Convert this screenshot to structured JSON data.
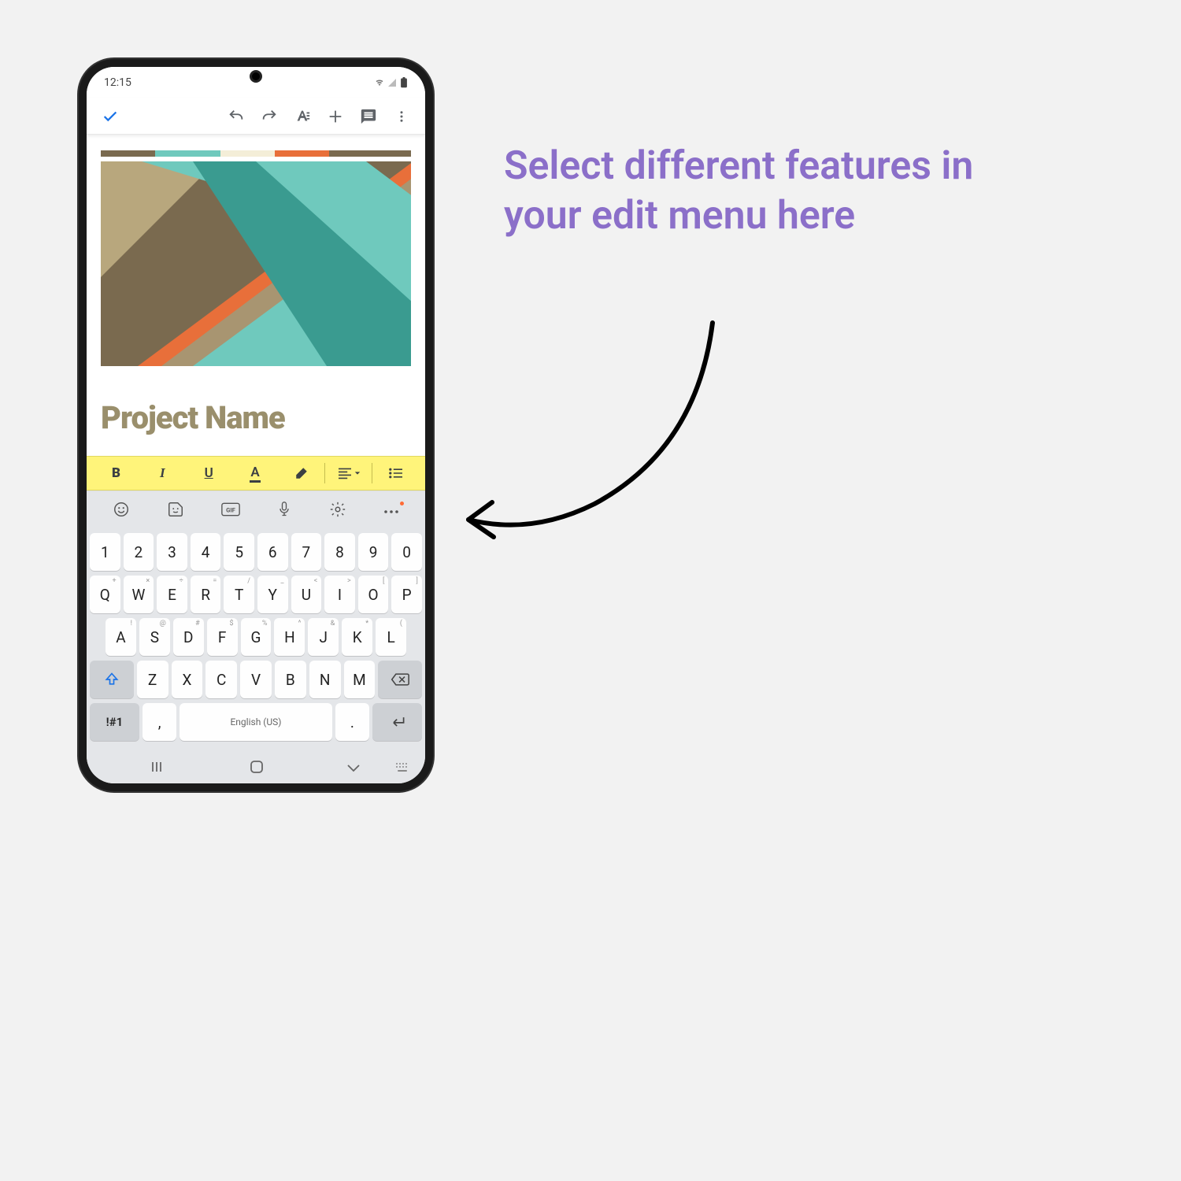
{
  "callout_text": "Select different features in your edit menu here",
  "status": {
    "time": "12:15"
  },
  "doc": {
    "title": "Project Name",
    "stripe_colors": [
      "#7a6a4f",
      "#6fc9bd",
      "#f4eed8",
      "#e86f3a",
      "#7a6a4f"
    ]
  },
  "format_toolbar": {
    "bold": "B",
    "italic": "I",
    "underline": "U",
    "text_color": "A"
  },
  "keyboard": {
    "row_numbers": [
      "1",
      "2",
      "3",
      "4",
      "5",
      "6",
      "7",
      "8",
      "9",
      "0"
    ],
    "row_q": [
      "Q",
      "W",
      "E",
      "R",
      "T",
      "Y",
      "U",
      "I",
      "O",
      "P"
    ],
    "row_q_hints": [
      "+",
      "×",
      "÷",
      "=",
      "/",
      "_",
      "<",
      ">",
      "[",
      "]"
    ],
    "row_a": [
      "A",
      "S",
      "D",
      "F",
      "G",
      "H",
      "J",
      "K",
      "L"
    ],
    "row_a_hints": [
      "!",
      "@",
      "#",
      "$",
      "%",
      "^",
      "&",
      "*",
      "("
    ],
    "row_z": [
      "Z",
      "X",
      "C",
      "V",
      "B",
      "N",
      "M"
    ],
    "row_z_hints": [
      "",
      "",
      "",
      "",
      "",
      "",
      ""
    ],
    "sym_key": "!#1",
    "comma": ",",
    "period": ".",
    "space_label": "English (US)"
  }
}
